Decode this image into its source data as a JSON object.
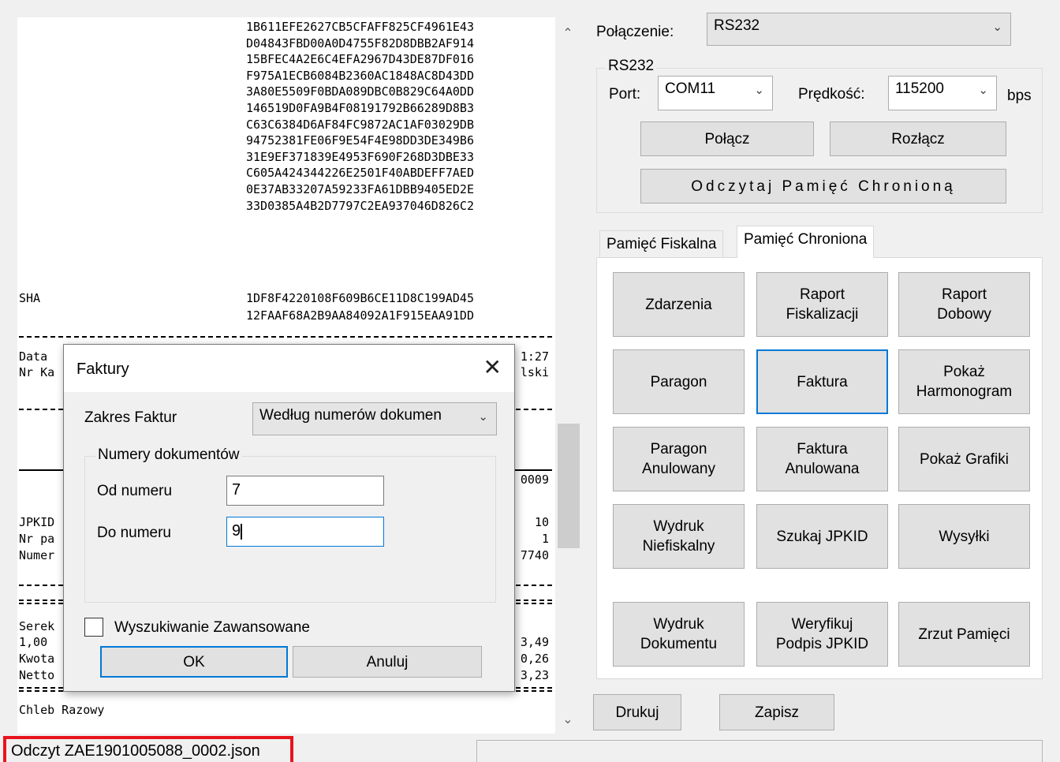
{
  "text_panel": {
    "hex_lines": [
      "1B611EFE2627CB5CFAFF825CF4961E43",
      "D04843FBD00A0D4755F82D8DBB2AF914",
      "15BFEC4A2E6C4EFA2967D43DE87DF016",
      "F975A1ECB6084B2360AC1848AC8D43DD",
      "3A80E5509F0BDA089DBC0B829C64A0DD",
      "146519D0FA9B4F08191792B66289D8B3",
      "C63C6384D6AF84FC9872AC1AF03029DB",
      "94752381FE06F9E54F4E98DD3DE349B6",
      "31E9EF371839E4953F690F268D3DBE33",
      "C605A424344226E2501F40ABDEFF7AED",
      "0E37AB33207A59233FA61DBB9405ED2E",
      "33D0385A4B2D7797C2EA937046D826C2"
    ],
    "sha_label": "SHA",
    "sha_lines": [
      "1DF8F4220108F609B6CE11D8C199AD45",
      "12FAAF68A2B9AA84092A1F915EAA91DD"
    ],
    "left_frag": [
      "Data",
      "Nr Ka",
      "JPKID",
      "Nr pa",
      "Numer",
      "Serek",
      "1,00",
      "Kwota",
      "Netto"
    ],
    "right_frag": [
      "1:27",
      "lski",
      "0009",
      "10",
      "1",
      "7740",
      "3,49",
      "0,26",
      "3,23"
    ],
    "last_line": "Chleb Razowy"
  },
  "status": {
    "filename": "Odczyt ZAE1901005088_0002.json"
  },
  "connection": {
    "label": "Połączenie:",
    "value": "RS232"
  },
  "rs232": {
    "group_title": "RS232",
    "port_label": "Port:",
    "port_value": "COM11",
    "speed_label": "Prędkość:",
    "speed_value": "115200",
    "unit": "bps",
    "connect_btn": "Połącz",
    "disconnect_btn": "Rozłącz",
    "read_btn": "Odczytaj Pamięć Chronioną"
  },
  "tabs": [
    "Pamięć Fiskalna",
    "Pamięć Chroniona"
  ],
  "grid_buttons": [
    "Zdarzenia",
    "Raport\nFiskalizacji",
    "Raport\nDobowy",
    "Paragon",
    "Faktura",
    "Pokaż\nHarmonogram",
    "Paragon\nAnulowany",
    "Faktura\nAnulowana",
    "Pokaż Grafiki",
    "Wydruk\nNiefiskalny",
    "Szukaj JPKID",
    "Wysyłki",
    "Wydruk\nDokumentu",
    "Weryfikuj\nPodpis JPKID",
    "Zrzut Pamięci"
  ],
  "bottom_buttons": {
    "print": "Drukuj",
    "save": "Zapisz"
  },
  "dialog": {
    "title": "Faktury",
    "range_label": "Zakres Faktur",
    "range_value": "Według numerów dokumen",
    "group_title": "Numery dokumentów",
    "from_label": "Od numeru",
    "from_value": "7",
    "to_label": "Do numeru",
    "to_value": "9",
    "advanced_label": "Wyszukiwanie Zawansowane",
    "ok": "OK",
    "cancel": "Anuluj"
  },
  "icons": [
    "chevron-down-icon",
    "close-icon",
    "scroll-up-icon",
    "scroll-down-icon",
    "checkbox-icon"
  ]
}
